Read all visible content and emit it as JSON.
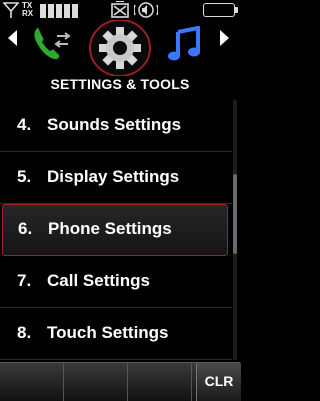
{
  "status_bar": {
    "tx_label": "TX",
    "rx_label": "RX",
    "icons": [
      "signal-icon",
      "tx-rx-icon",
      "signal-bars-icon",
      "alarm-icon",
      "sound-icon",
      "battery-icon"
    ]
  },
  "carousel": {
    "title": "SETTINGS & TOOLS",
    "icons": [
      "phone-transfer-icon",
      "gear-icon",
      "music-note-icon"
    ]
  },
  "menu": {
    "items": [
      {
        "num": "4.",
        "label": "Sounds Settings"
      },
      {
        "num": "5.",
        "label": "Display Settings"
      },
      {
        "num": "6.",
        "label": "Phone Settings",
        "selected": true
      },
      {
        "num": "7.",
        "label": "Call Settings"
      },
      {
        "num": "8.",
        "label": "Touch Settings"
      }
    ]
  },
  "softkeys": {
    "clr_label": "CLR"
  },
  "colors": {
    "selection_border": "#a4202a",
    "gear_ring": "#9b1c24",
    "phone_green": "#2faa2f",
    "music_blue": "#3b78ff"
  }
}
